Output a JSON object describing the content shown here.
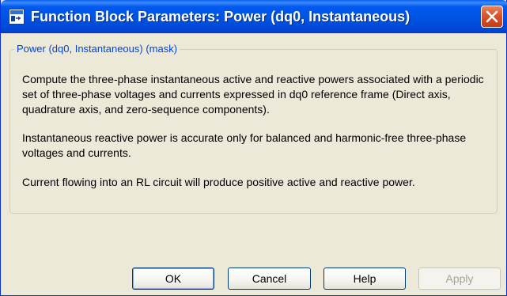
{
  "window": {
    "title": "Function Block Parameters: Power (dq0, Instantaneous)"
  },
  "group": {
    "legend": "Power (dq0, Instantaneous) (mask)"
  },
  "description": {
    "paragraph1": "Compute the three-phase instantaneous active and reactive powers associated with a periodic set of three-phase voltages and currents expressed in dq0 reference frame (Direct axis, quadrature axis, and zero-sequence components).",
    "paragraph2": "Instantaneous reactive power is accurate only for balanced and harmonic-free three-phase voltages and currents.",
    "paragraph3": "Current flowing into an RL circuit will produce  positive active and reactive power."
  },
  "buttons": {
    "ok": "OK",
    "cancel": "Cancel",
    "help": "Help",
    "apply": "Apply"
  },
  "icons": {
    "app": "simulink-block-icon",
    "close": "close-icon"
  },
  "colors": {
    "titlebar": "#0055e5",
    "legend": "#0046d5",
    "close": "#d9542a",
    "background": "#ece9d8"
  }
}
